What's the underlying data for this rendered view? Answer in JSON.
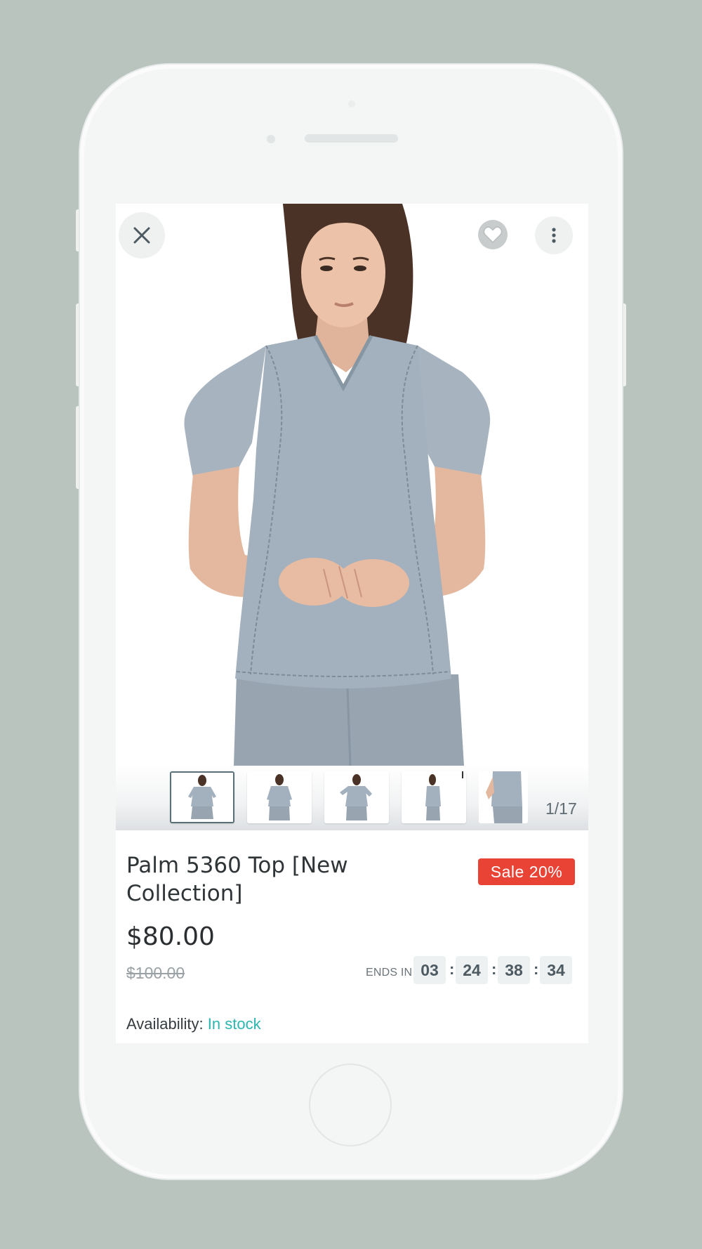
{
  "product": {
    "title": "Palm 5360 Top [New Collection]",
    "sale_badge": "Sale 20%",
    "price": "$80.00",
    "old_price": "$100.00"
  },
  "gallery": {
    "counter": "1/17"
  },
  "countdown": {
    "label": "ENDS IN",
    "days": "03",
    "hours": "24",
    "minutes": "38",
    "seconds": "34",
    "separator": ":"
  },
  "availability": {
    "label": "Availability:",
    "value": "In stock"
  },
  "icons": {
    "close": "close-icon",
    "favorite": "heart-icon",
    "menu": "more-vertical-icon"
  },
  "colors": {
    "sale": "#e94336",
    "in_stock": "#2cb6b0",
    "background": "#b9c4bf",
    "scrubs": "#a3b0bd"
  }
}
